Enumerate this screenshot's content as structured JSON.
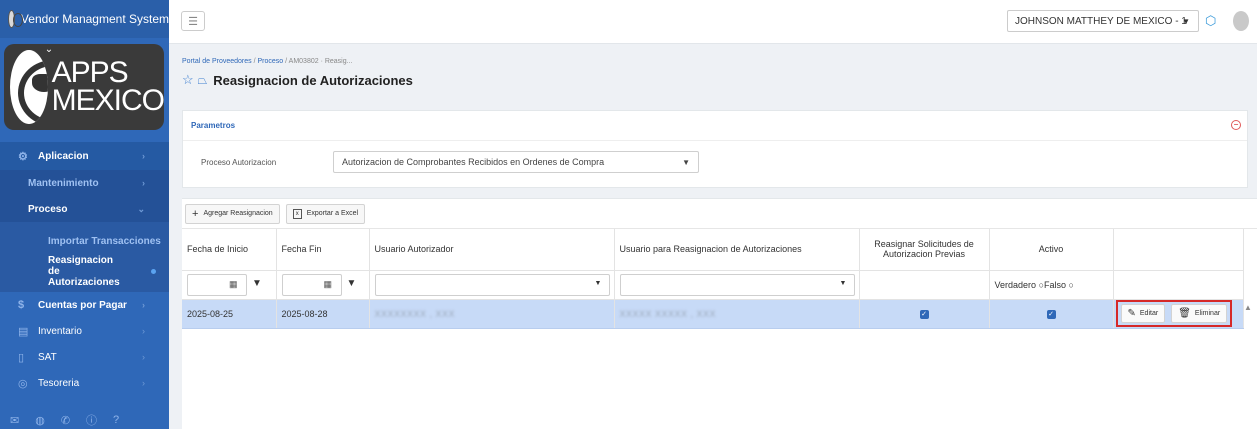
{
  "app": {
    "title": "Vendor Managment System"
  },
  "logo": {
    "line1": "APPS",
    "line2": "MEXICO"
  },
  "sidebar": {
    "items": [
      {
        "label": "Aplicacion"
      },
      {
        "label": "Mantenimiento"
      },
      {
        "label": "Proceso"
      },
      {
        "label": "Importar Transacciones"
      },
      {
        "label": "Reasignacion de Autorizaciones"
      },
      {
        "label": "Cuentas por Pagar"
      },
      {
        "label": "Inventario"
      },
      {
        "label": "SAT"
      },
      {
        "label": "Tesoreria"
      }
    ]
  },
  "topbar": {
    "company": "JOHNSON MATTHEY DE MEXICO - 1"
  },
  "breadcrumb": {
    "root": "Portal de Proveedores",
    "mid": "Proceso",
    "leaf": "AM03802 · Reasig..."
  },
  "page": {
    "title": "Reasignacion de Autorizaciones"
  },
  "params": {
    "header": "Parametros",
    "label": "Proceso Autorizacion",
    "value": "Autorizacion de Comprobantes Recibidos en Ordenes de Compra"
  },
  "toolbar": {
    "add_label": "Agregar Reasignacion",
    "export_label": "Exportar a Excel"
  },
  "grid": {
    "columns": [
      "Fecha de Inicio",
      "Fecha Fin",
      "Usuario Autorizador",
      "Usuario para Reasignacion de Autorizaciones",
      "Reasignar Solicitudes de Autorizacion Previas",
      "Activo"
    ],
    "filter_bool": {
      "true_label": "Verdadero",
      "false_label": "Falso"
    },
    "rows": [
      {
        "start": "2025-08-25",
        "end": "2025-08-28",
        "authorizer": "XXXXXXXX , XXX",
        "reassign_to": "XXXXX XXXXX , XXX",
        "reassign_prev": true,
        "active": true
      }
    ],
    "edit_label": "Editar",
    "delete_label": "Eliminar"
  },
  "colors": {
    "sidebar": "#2f68b8",
    "accent": "#2f68b8",
    "row_selected": "#c7daf7",
    "highlight": "#d62828"
  }
}
